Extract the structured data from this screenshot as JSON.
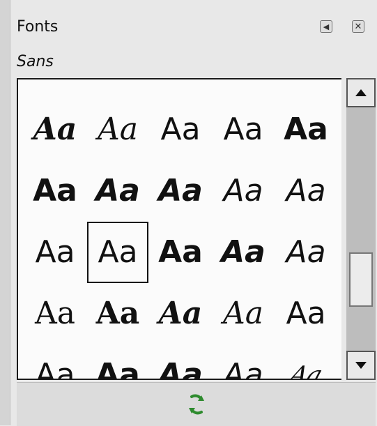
{
  "header": {
    "title": "Fonts",
    "current_font": "Sans"
  },
  "font_list": {
    "sample_text": "Aa",
    "rows": [
      [
        "italic-serif-bold",
        "italic-serif",
        "sans-regular",
        "sans-regular",
        "sans-bold"
      ],
      [
        "sans-bold",
        "sans-bold-italic",
        "sans-bold-italic",
        "sans-italic",
        "sans-italic"
      ],
      [
        "sans-regular",
        "sans-regular",
        "sans-bold",
        "sans-bold-italic",
        "sans-italic"
      ],
      [
        "serif-regular",
        "serif-bold",
        "serif-bold-italic",
        "serif-italic",
        "sans-regular"
      ],
      [
        "sans-regular",
        "sans-bold",
        "sans-bold-italic",
        "sans-italic",
        "script"
      ]
    ],
    "selected_index": [
      2,
      1
    ]
  },
  "icons": {
    "panel_menu": "left-triangle-icon",
    "close": "close-x-icon",
    "refresh": "refresh-icon",
    "scroll_up": "up-arrow-icon",
    "scroll_down": "down-arrow-icon"
  }
}
